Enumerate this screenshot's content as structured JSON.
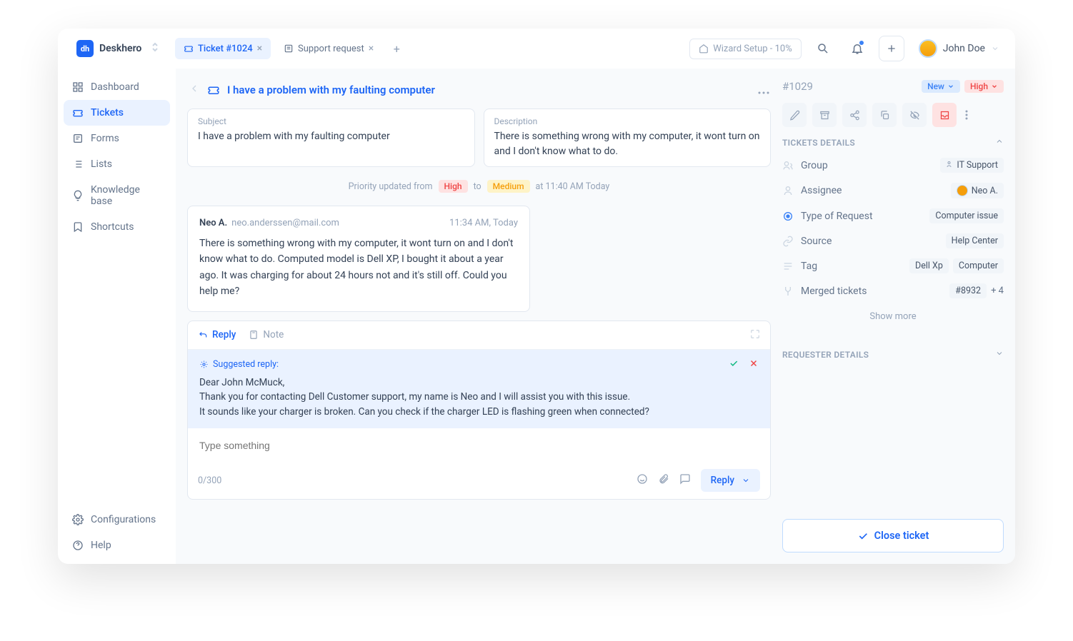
{
  "brand": "Deskhero",
  "tabs": [
    {
      "label": "Ticket #1024",
      "active": true
    },
    {
      "label": "Support request",
      "active": false
    }
  ],
  "wizard": "Wizard Setup - 10%",
  "user": "John Doe",
  "sidebar": {
    "items": [
      {
        "label": "Dashboard"
      },
      {
        "label": "Tickets"
      },
      {
        "label": "Forms"
      },
      {
        "label": "Lists"
      },
      {
        "label": "Knowledge base"
      },
      {
        "label": "Shortcuts"
      }
    ],
    "bottom": [
      {
        "label": "Configurations"
      },
      {
        "label": "Help"
      }
    ]
  },
  "ticket": {
    "title": "I have a problem with my faulting computer",
    "subject_label": "Subject",
    "subject": "I have a problem with my faulting computer",
    "description_label": "Description",
    "description": "There is something wrong with my computer, it wont turn on and I don't know what to do.",
    "log": {
      "prefix": "Priority updated from",
      "from": "High",
      "to_word": "to",
      "to": "Medium",
      "time": "at 11:40 AM Today"
    },
    "msg": {
      "name": "Neo A.",
      "email": "neo.anderssen@mail.com",
      "time": "11:34 AM, Today",
      "body": "There is something wrong with my computer, it wont turn on and I don't know what to do. Computed model is Dell XP, I bought it about a year ago. It was charging for about 24 hours not and it's still off. Could you help me?"
    }
  },
  "reply": {
    "tab_reply": "Reply",
    "tab_note": "Note",
    "sugg_label": "Suggested reply:",
    "sugg_body": "Dear John McMuck,\nThank you for contacting Dell Customer support, my name is Neo and I will assist you with this issue.\nIt sounds like your charger is broken. Can you check if the charger LED is flashing green when connected?",
    "placeholder": "Type something",
    "counter": "0/300",
    "btn": "Reply"
  },
  "panel": {
    "id": "#1029",
    "status": "New",
    "priority": "High",
    "details_hdr": "TICKETS DETAILS",
    "rows": {
      "group_l": "Group",
      "group_v": "IT Support",
      "assignee_l": "Assignee",
      "assignee_v": "Neo A.",
      "type_l": "Type of Request",
      "type_v": "Computer issue",
      "source_l": "Source",
      "source_v": "Help Center",
      "tag_l": "Tag",
      "tag_v1": "Dell Xp",
      "tag_v2": "Computer",
      "merged_l": "Merged tickets",
      "merged_v": "#8932",
      "merged_more": "+ 4"
    },
    "show_more": "Show more",
    "requester_hdr": "REQUESTER DETAILS",
    "close": "Close ticket"
  }
}
